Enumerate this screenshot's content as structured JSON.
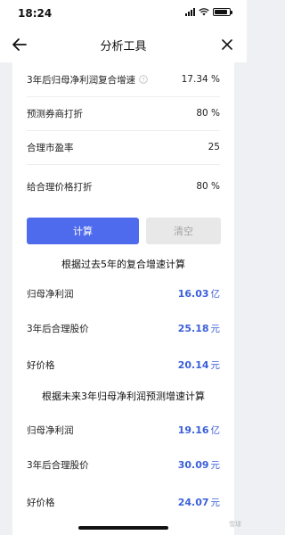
{
  "status_bar": {
    "time": "18:24"
  },
  "nav": {
    "title": "分析工具"
  },
  "inputs": [
    {
      "label": "3年后归母净利润复合增速",
      "value": "17.34 %"
    },
    {
      "label": "预测券商打折",
      "value": "80  %"
    },
    {
      "label": "合理市盈率",
      "value": "25"
    },
    {
      "label": "给合理价格打折",
      "value": "80  %"
    }
  ],
  "buttons": {
    "calculate": "计算",
    "clear": "清空"
  },
  "section1": {
    "title": "根据过去5年的复合增速计算",
    "rows": [
      {
        "label": "归母净利润",
        "value": "16.03",
        "unit": "亿"
      },
      {
        "label": "3年后合理股价",
        "value": "25.18",
        "unit": "元"
      },
      {
        "label": "好价格",
        "value": "20.14",
        "unit": "元"
      }
    ]
  },
  "section2": {
    "title": "根据未来3年归母净利润预测增速计算",
    "rows": [
      {
        "label": "归母净利润",
        "value": "19.16",
        "unit": "亿"
      },
      {
        "label": "3年后合理股价",
        "value": "30.09",
        "unit": "元"
      },
      {
        "label": "好价格",
        "value": "24.07",
        "unit": "元"
      }
    ]
  },
  "watermark": "雪球",
  "colors": {
    "accent": "#4f6bed",
    "result": "#3b5fd9",
    "background": "#eef0f4"
  },
  "icons": {
    "back": "arrow-left-icon",
    "close": "close-icon",
    "help": "question-circle-icon"
  }
}
